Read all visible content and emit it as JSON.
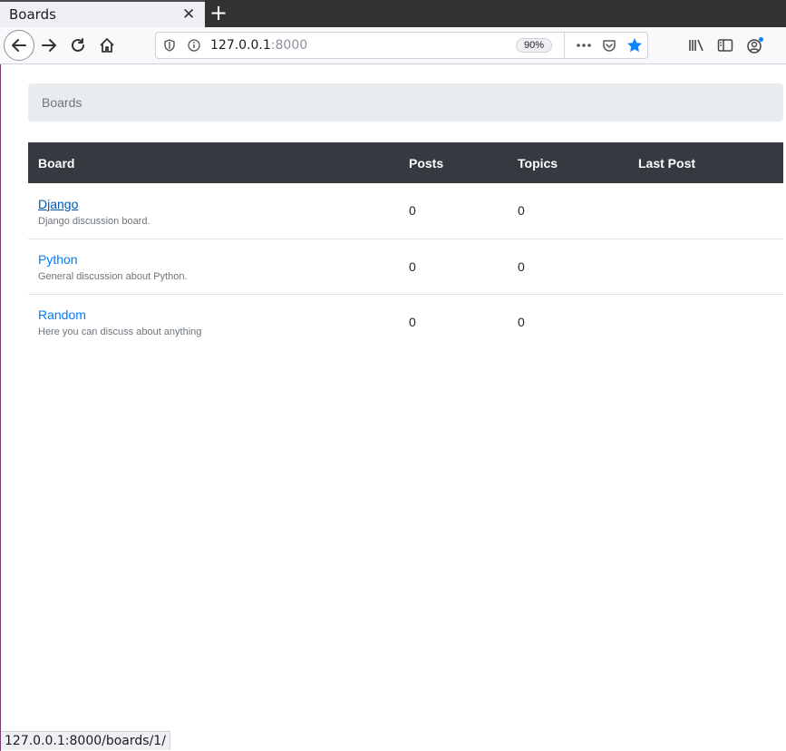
{
  "browser": {
    "tab_title": "Boards",
    "url_host": "127.0.0.1",
    "url_port": ":8000",
    "zoom": "90%",
    "status_url": "127.0.0.1:8000/boards/1/"
  },
  "page": {
    "breadcrumb": "Boards",
    "table": {
      "headers": [
        "Board",
        "Posts",
        "Topics",
        "Last Post"
      ],
      "rows": [
        {
          "name": "Django",
          "description": "Django discussion board.",
          "posts": "0",
          "topics": "0",
          "last_post": ""
        },
        {
          "name": "Python",
          "description": "General discussion about Python.",
          "posts": "0",
          "topics": "0",
          "last_post": ""
        },
        {
          "name": "Random",
          "description": "Here you can discuss about anything",
          "posts": "0",
          "topics": "0",
          "last_post": ""
        }
      ]
    }
  },
  "colors": {
    "link": "#007bff",
    "table_header_bg": "#343a40",
    "breadcrumb_bg": "#e9ecef",
    "bookmark_star": "#0a84ff"
  }
}
